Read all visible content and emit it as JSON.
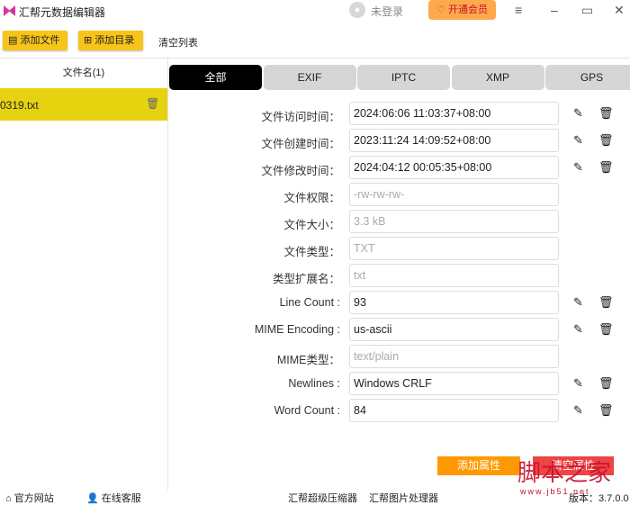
{
  "app": {
    "title": "汇帮元数据编辑器",
    "login": "未登录",
    "vip": "开通会员"
  },
  "toolbar": {
    "add_file": "添加文件",
    "add_dir": "添加目录",
    "clear_list": "清空列表"
  },
  "filelist": {
    "header": "文件名(1)",
    "files": [
      "0319.txt"
    ]
  },
  "tabs": [
    "全部",
    "EXIF",
    "IPTC",
    "XMP",
    "GPS"
  ],
  "rows": [
    {
      "label": "文件访问时间：",
      "value": "2024:06:06 11:03:37+08:00",
      "editable": true
    },
    {
      "label": "文件创建时间：",
      "value": "2023:11:24 14:09:52+08:00",
      "editable": true
    },
    {
      "label": "文件修改时间：",
      "value": "2024:04:12 00:05:35+08:00",
      "editable": true
    },
    {
      "label": "文件权限：",
      "value": "-rw-rw-rw-",
      "editable": false
    },
    {
      "label": "文件大小：",
      "value": "3.3 kB",
      "editable": false
    },
    {
      "label": "文件类型：",
      "value": "TXT",
      "editable": false
    },
    {
      "label": "类型扩展名：",
      "value": "txt",
      "editable": false
    },
    {
      "label": "Line Count :",
      "value": "93",
      "editable": true
    },
    {
      "label": "MIME Encoding :",
      "value": "us-ascii",
      "editable": true
    },
    {
      "label": "MIME类型：",
      "value": "text/plain",
      "editable": false
    },
    {
      "label": "Newlines :",
      "value": "Windows CRLF",
      "editable": true
    },
    {
      "label": "Word Count :",
      "value": "84",
      "editable": true
    }
  ],
  "actions": {
    "add_attr": "添加属性",
    "clear_attr": "清空属性"
  },
  "footer": {
    "website": "官方网站",
    "support": "在线客服",
    "compressor": "汇帮超级压缩器",
    "image_tool": "汇帮图片处理器",
    "version": "版本：3.7.0.0"
  },
  "watermark": {
    "text": "脚本之家",
    "url": "www.jb51.net"
  },
  "colors": {
    "accent": "#f7c51a",
    "selected": "#e7d20f",
    "add": "#ff9900",
    "clear": "#ee4444"
  }
}
